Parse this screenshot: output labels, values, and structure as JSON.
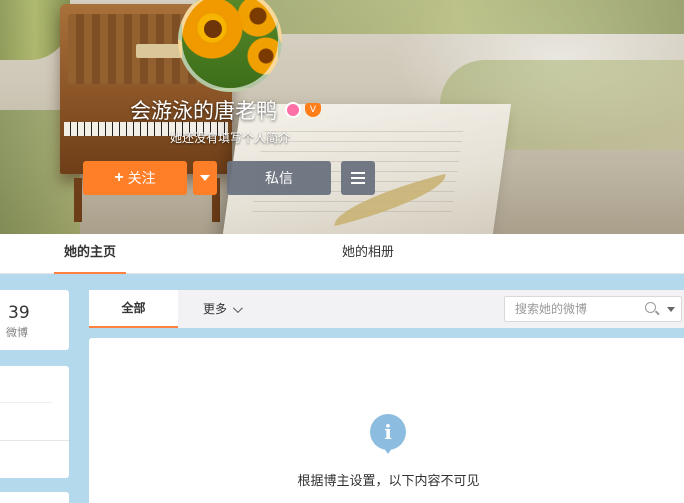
{
  "profile": {
    "name": "会游泳的唐老鸭",
    "bio": "她还没有填写个人简介",
    "vip_badge": "V"
  },
  "actions": {
    "follow_label": "关注",
    "follow_icon": "plus-icon",
    "message_label": "私信",
    "more_icon": "menu-icon"
  },
  "nav": {
    "tabs": [
      {
        "label": "她的主页",
        "active": true
      },
      {
        "label": "她的相册",
        "active": false
      }
    ]
  },
  "stats": {
    "count": "39",
    "label": "微博"
  },
  "feed": {
    "tab_all": "全部",
    "tab_more": "更多",
    "search_placeholder": "搜索她的微博"
  },
  "notice": {
    "message": "根据博主设置，以下内容不可见"
  },
  "colors": {
    "accent": "#ff7e28",
    "tab_underline": "#ff8140",
    "secondary_button": "#6b7380",
    "page_background": "#b4d8ec",
    "info_icon": "#8cbde0"
  }
}
